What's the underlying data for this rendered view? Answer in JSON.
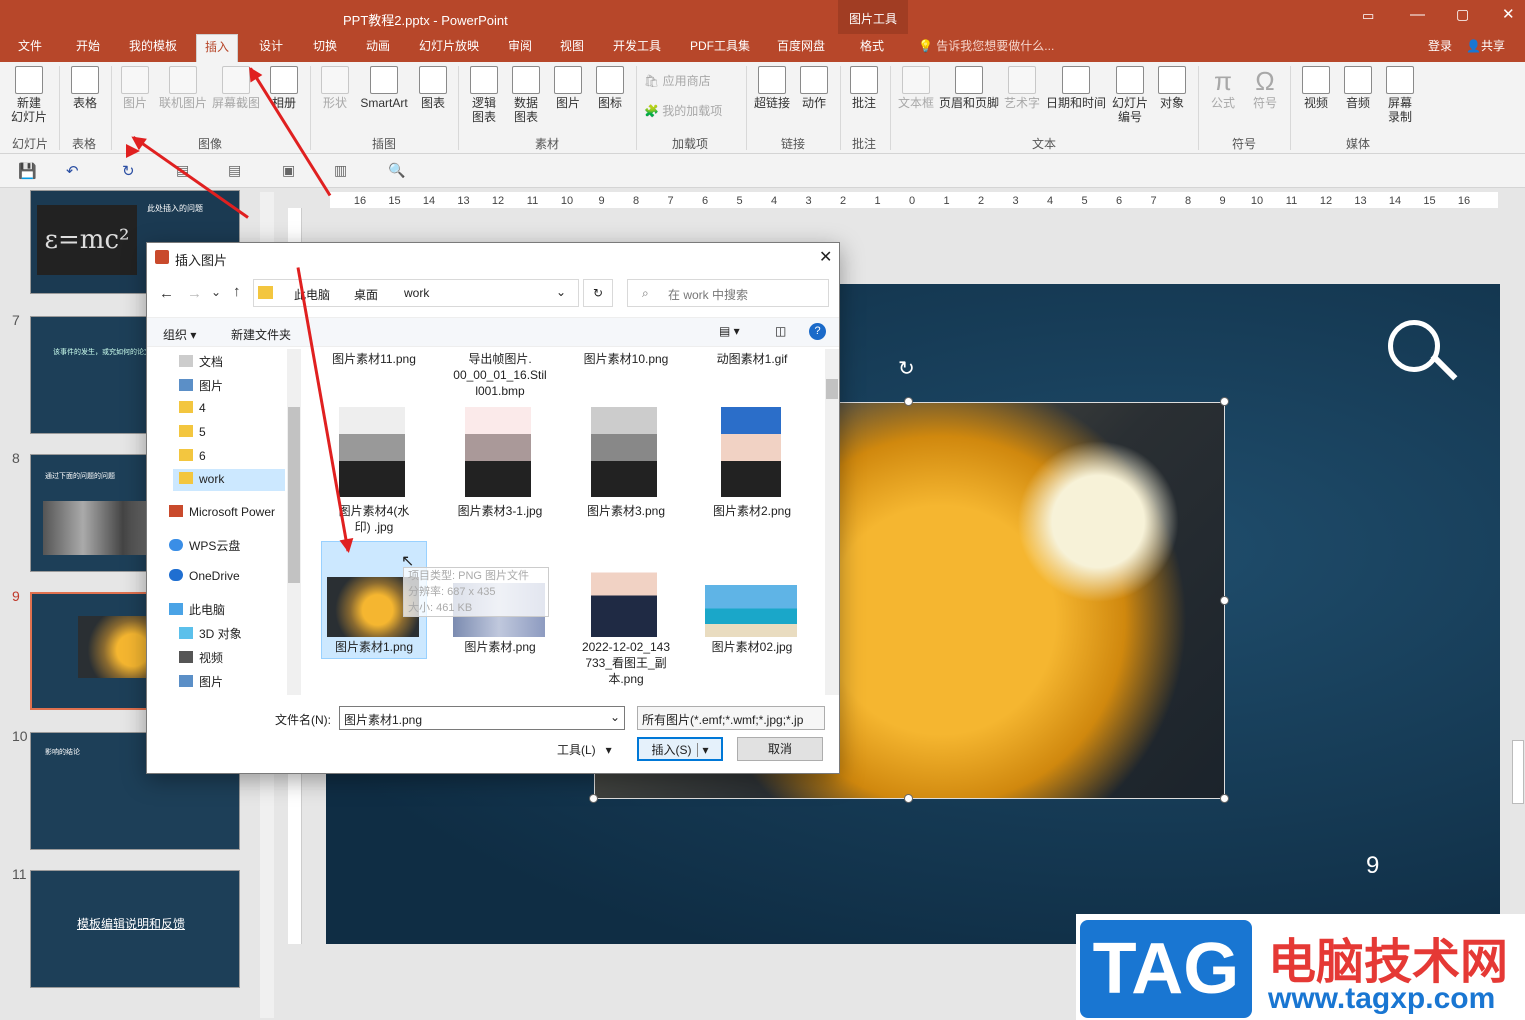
{
  "window": {
    "title": "PPT教程2.pptx - PowerPoint",
    "context_tab": "图片工具"
  },
  "tabs": [
    "文件",
    "开始",
    "我的模板",
    "插入",
    "设计",
    "切换",
    "动画",
    "幻灯片放映",
    "审阅",
    "视图",
    "开发工具",
    "PDF工具集",
    "百度网盘",
    "格式"
  ],
  "tell_me": "告诉我您想要做什么...",
  "login": "登录",
  "share": "共享",
  "ribbon": {
    "new_slide": "新建\n幻灯片",
    "table": "表格",
    "picture": "图片",
    "online_picture": "联机图片",
    "screenshot": "屏幕截图",
    "album": "相册",
    "shapes": "形状",
    "smartart": "SmartArt",
    "chart": "图表",
    "logic_chart": "逻辑\n图表",
    "data_chart": "数据\n图表",
    "pic2": "图片",
    "icon": "图标",
    "app_store": "应用商店",
    "my_addins": "我的加载项",
    "hyperlink": "超链接",
    "action": "动作",
    "comment": "批注",
    "textbox": "文本框",
    "header_footer": "页眉和页脚",
    "wordart": "艺术字",
    "datetime": "日期和时间",
    "slide_number": "幻灯片\n编号",
    "object": "对象",
    "equation": "公式",
    "symbol": "符号",
    "video": "视频",
    "audio": "音频",
    "screen_record": "屏幕\n录制",
    "groups": [
      "幻灯片",
      "表格",
      "图像",
      "插图",
      "素材",
      "加载项",
      "链接",
      "批注",
      "文本",
      "符号",
      "媒体"
    ]
  },
  "ruler_labels": [
    "16",
    "15",
    "14",
    "13",
    "12",
    "11",
    "10",
    "9",
    "8",
    "7",
    "6",
    "5",
    "4",
    "3",
    "2",
    "1",
    "0",
    "1",
    "2",
    "3",
    "4",
    "5",
    "6",
    "7",
    "8",
    "9",
    "10",
    "11",
    "12",
    "13",
    "14",
    "15",
    "16"
  ],
  "slides": [
    {
      "num": "7",
      "text": "该事件的发生，或究如何的论文"
    },
    {
      "num": "8",
      "text": "通过下面的问题的问题"
    },
    {
      "num": "9",
      "text": ""
    },
    {
      "num": "10",
      "text": "影响的结论"
    },
    {
      "num": "11",
      "text": "模板编辑说明和反馈"
    }
  ],
  "slide_top_text": "此处插入的问题",
  "slide_number_main": "9",
  "dialog": {
    "title": "插入图片",
    "path": [
      "此电脑",
      "桌面",
      "work"
    ],
    "search_placeholder": "在 work 中搜索",
    "organize": "组织",
    "new_folder": "新建文件夹",
    "nav": [
      "文档",
      "图片",
      "4",
      "5",
      "6",
      "work",
      "Microsoft Power",
      "WPS云盘",
      "OneDrive",
      "此电脑",
      "3D 对象",
      "视频",
      "图片"
    ],
    "files_row1": [
      "图片素材11.png",
      "导出帧图片.\n00_00_01_16.Stil\nl001.bmp",
      "图片素材10.png",
      "动图素材1.gif"
    ],
    "files_row2": [
      "图片素材4(水\n印) .jpg",
      "图片素材3-1.jpg",
      "图片素材3.png",
      "图片素材2.png"
    ],
    "files_row3": [
      "图片素材1.png",
      "图片素材.png",
      "2022-12-02_143\n733_看图王_副\n本.png",
      "图片素材02.jpg"
    ],
    "tooltip": [
      "项目类型: PNG 图片文件",
      "分辨率: 687 x 435",
      "大小: 461 KB"
    ],
    "filename_label": "文件名(N):",
    "filename_value": "图片素材1.png",
    "filetype": "所有图片(*.emf;*.wmf;*.jpg;*.jp",
    "tools": "工具(L)",
    "insert": "插入(S)",
    "cancel": "取消"
  },
  "watermark": {
    "logo": "TAG",
    "site_name": "电脑技术网",
    "url": "www.tagxp.com"
  },
  "colors": {
    "brand": "#b7472a",
    "accent_red": "#e02020",
    "selection": "#cce8ff"
  }
}
